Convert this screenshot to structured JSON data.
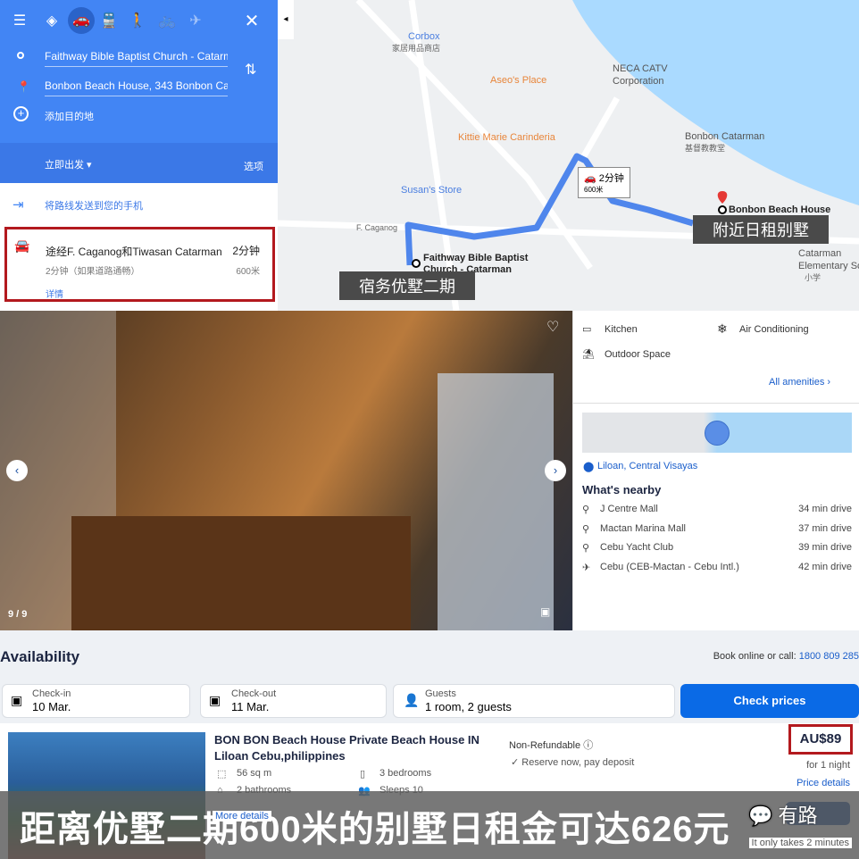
{
  "directions": {
    "modes": [
      "best-route",
      "car",
      "transit",
      "walk",
      "bicycle",
      "flight"
    ],
    "origin": "Faithway Bible Baptist Church - Catarm",
    "destination": "Bonbon Beach House, 343 Bonbon Cat",
    "add_destination": "添加目的地",
    "depart_now": "立即出发",
    "options": "选项",
    "send_to_phone": "将路线发送到您的手机",
    "route": {
      "via": "途经F. Caganog和Tiwasan Catarman",
      "time": "2分钟",
      "sub": "2分钟（如果道路通畅）",
      "distance": "600米",
      "details": "详情"
    }
  },
  "map": {
    "places": [
      "Corbox",
      "家居用品商店",
      "Aseo's Place",
      "NECA CATV",
      "Corporation",
      "Kittie Marie Carinderia",
      "Bonbon Catarman",
      "基督教教堂",
      "Susan's Store",
      "F. Caganog",
      "Faithway Bible Baptist",
      "Church - Catarman",
      "Bonbon Beach House",
      "Catarman",
      "Elementary Sc",
      "小学"
    ],
    "bubble_time": "2分钟",
    "bubble_distance": "600米",
    "tag_origin": "宿务优墅二期",
    "tag_destination": "附近日租别墅"
  },
  "photo": {
    "counter": "9 / 9"
  },
  "amenities": {
    "items": [
      "Kitchen",
      "Air Conditioning",
      "Outdoor Space"
    ],
    "all_link": "All amenities",
    "location": "Liloan, Central Visayas",
    "nearby_title": "What's nearby",
    "nearby": [
      {
        "name": "J Centre Mall",
        "time": "34 min drive",
        "icon": "pin"
      },
      {
        "name": "Mactan Marina Mall",
        "time": "37 min drive",
        "icon": "pin"
      },
      {
        "name": "Cebu Yacht Club",
        "time": "39 min drive",
        "icon": "pin"
      },
      {
        "name": "Cebu (CEB-Mactan - Cebu Intl.)",
        "time": "42 min drive",
        "icon": "plane"
      }
    ]
  },
  "availability": {
    "title": "Availability",
    "book_label": "Book online or call:",
    "phone": "1800 809 285",
    "checkin_label": "Check-in",
    "checkin": "10 Mar.",
    "checkout_label": "Check-out",
    "checkout": "11 Mar.",
    "guests_label": "Guests",
    "guests": "1 room, 2 guests",
    "check_prices": "Check prices",
    "listing": {
      "title": "BON BON Beach House Private Beach House IN Liloan Cebu,philippines",
      "area": "56 sq m",
      "bedrooms": "3 bedrooms",
      "bathrooms": "2 bathrooms",
      "sleeps": "Sleeps 10",
      "more": "More details",
      "refund": "Non-Refundable",
      "reserve": "Reserve now, pay deposit",
      "price": "AU$89",
      "per": "for 1 night",
      "price_details": "Price details",
      "note": "It only takes 2 minutes"
    }
  },
  "caption": "距离优墅二期600米的别墅日租金可达626元",
  "watermark": "有路",
  "colors": {
    "google_blue": "#4285f4",
    "highlight_red": "#b3191e",
    "book_blue": "#0a6ae6"
  }
}
